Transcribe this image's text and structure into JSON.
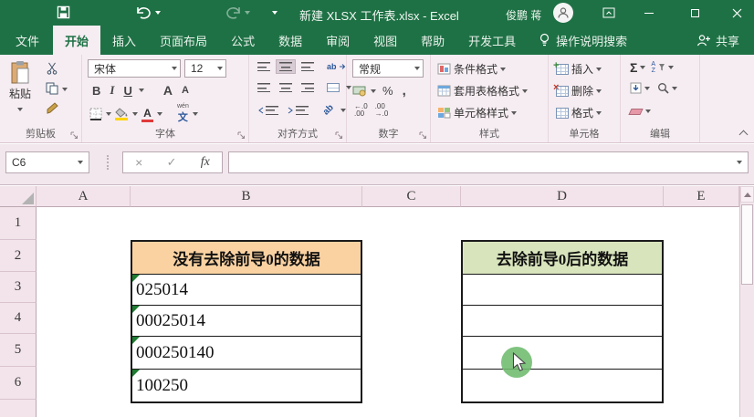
{
  "window": {
    "title": "新建 XLSX 工作表.xlsx - Excel",
    "user": "俊鹏 蒋"
  },
  "tabs": {
    "file": "文件",
    "items": [
      "开始",
      "插入",
      "页面布局",
      "公式",
      "数据",
      "审阅",
      "视图",
      "帮助",
      "开发工具"
    ],
    "active": "开始",
    "search": "操作说明搜索",
    "share": "共享"
  },
  "ribbon": {
    "clipboard": {
      "paste": "粘贴",
      "label": "剪贴板"
    },
    "font": {
      "family": "宋体",
      "size": "12",
      "bold": "B",
      "italic": "I",
      "underline": "U",
      "letter_a": "A",
      "pinyin_small": "wén",
      "pinyin": "文",
      "label": "字体"
    },
    "alignment": {
      "wrap": "ab",
      "orient": "ab",
      "label": "对齐方式"
    },
    "number": {
      "format": "常规",
      "percent": "%",
      "comma": ",",
      "inc_top": "←.0",
      "inc_bot": ".00",
      "dec_top": ".00",
      "dec_bot": "→.0",
      "label": "数字"
    },
    "styles": {
      "conditional": "条件格式",
      "table_format": "套用表格格式",
      "cell_styles": "单元格样式",
      "label": "样式"
    },
    "cells": {
      "insert": "插入",
      "delete": "删除",
      "format": "格式",
      "label": "单元格"
    },
    "editing": {
      "autosum": "Σ",
      "sort_a": "A",
      "sort_z": "Z",
      "label": "编辑"
    }
  },
  "formula_bar": {
    "cell_ref": "C6",
    "cancel": "×",
    "enter": "✓",
    "fx": "fx"
  },
  "sheet": {
    "col_headers": [
      "A",
      "B",
      "C",
      "D",
      "E"
    ],
    "row_headers": [
      "1",
      "2",
      "3",
      "4",
      "5",
      "6"
    ],
    "left_table": {
      "title": "没有去除前导0的数据",
      "rows": [
        "025014",
        "00025014",
        "000250140",
        "100250"
      ]
    },
    "right_table": {
      "title": "去除前导0后的数据",
      "rows": [
        "",
        "",
        "",
        ""
      ]
    }
  },
  "colors": {
    "excel_green": "#1e7145",
    "left_header_fill": "#fad2a2",
    "right_header_fill": "#d8e4bc",
    "error_triangle": "#1e7d32",
    "click_highlight": "#6dbb6d"
  }
}
